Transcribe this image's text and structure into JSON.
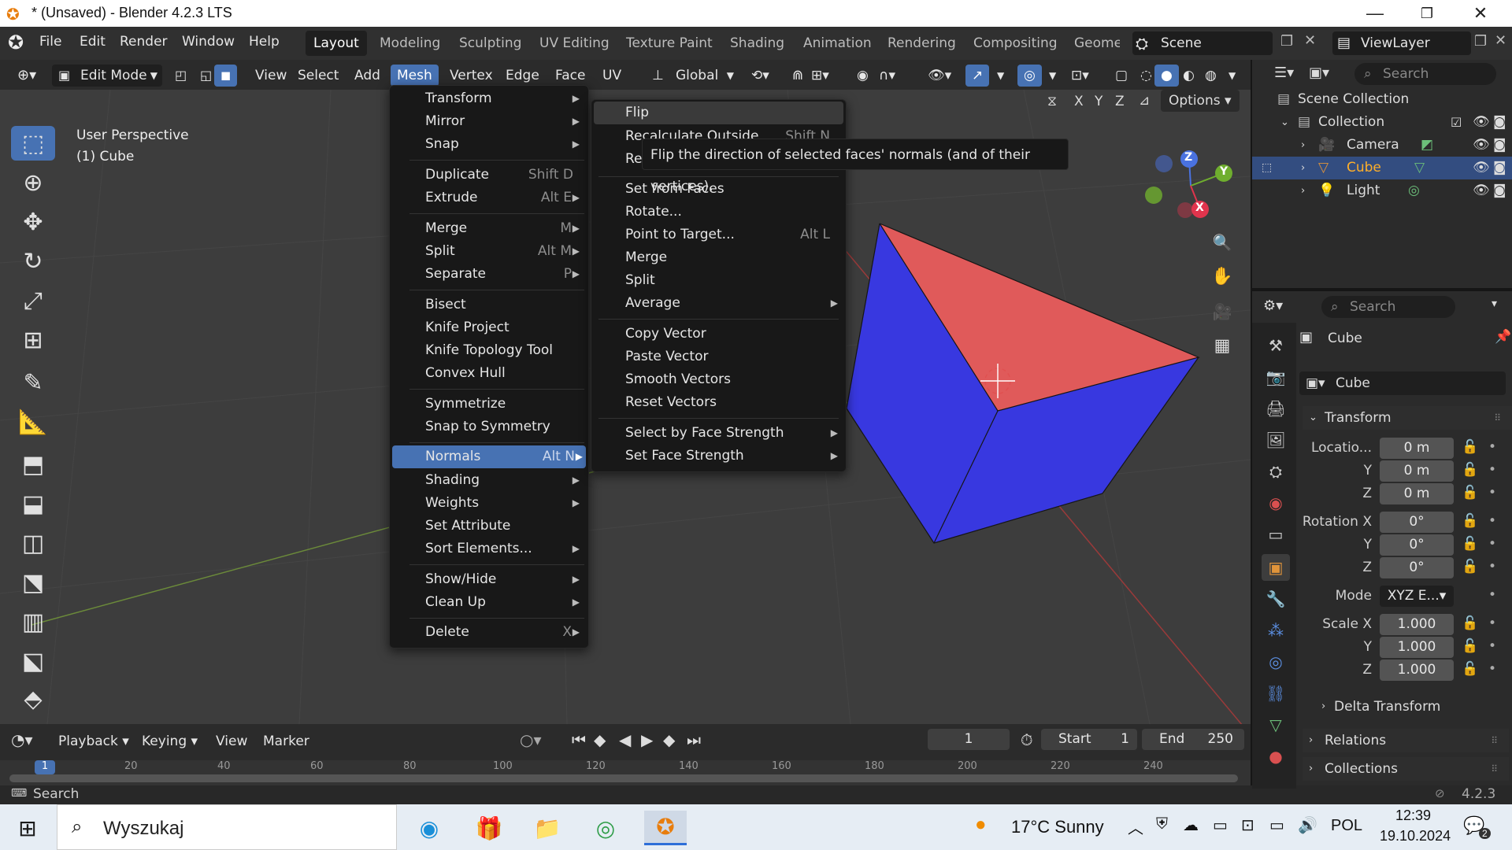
{
  "window": {
    "title": "* (Unsaved) - Blender 4.2.3 LTS"
  },
  "topbar": {
    "menus": [
      "File",
      "Edit",
      "Render",
      "Window",
      "Help"
    ],
    "workspaces": [
      "Layout",
      "Modeling",
      "Sculpting",
      "UV Editing",
      "Texture Paint",
      "Shading",
      "Animation",
      "Rendering",
      "Compositing",
      "Geome"
    ],
    "scene": "Scene",
    "view_layer": "ViewLayer"
  },
  "viewport_header": {
    "mode": "Edit Mode",
    "menus": [
      "View",
      "Select",
      "Add",
      "Mesh",
      "Vertex",
      "Edge",
      "Face",
      "UV"
    ],
    "orientation": "Global",
    "axes": [
      "X",
      "Y",
      "Z"
    ],
    "options": "Options"
  },
  "viewport": {
    "perspective": "User Perspective",
    "object": "(1) Cube"
  },
  "mesh_menu": [
    {
      "label": "Transform",
      "shortcut": "",
      "sub": true
    },
    {
      "label": "Mirror",
      "shortcut": "",
      "sub": true
    },
    {
      "label": "Snap",
      "shortcut": "",
      "sub": true
    },
    {
      "label": "Duplicate",
      "shortcut": "Shift D",
      "sub": false
    },
    {
      "label": "Extrude",
      "shortcut": "Alt E",
      "sub": true
    },
    {
      "label": "Merge",
      "shortcut": "M",
      "sub": true
    },
    {
      "label": "Split",
      "shortcut": "Alt M",
      "sub": true
    },
    {
      "label": "Separate",
      "shortcut": "P",
      "sub": true
    },
    {
      "label": "Bisect",
      "shortcut": "",
      "sub": false
    },
    {
      "label": "Knife Project",
      "shortcut": "",
      "sub": false
    },
    {
      "label": "Knife Topology Tool",
      "shortcut": "",
      "sub": false
    },
    {
      "label": "Convex Hull",
      "shortcut": "",
      "sub": false
    },
    {
      "label": "Symmetrize",
      "shortcut": "",
      "sub": false
    },
    {
      "label": "Snap to Symmetry",
      "shortcut": "",
      "sub": false
    },
    {
      "label": "Normals",
      "shortcut": "Alt N",
      "sub": true
    },
    {
      "label": "Shading",
      "shortcut": "",
      "sub": true
    },
    {
      "label": "Weights",
      "shortcut": "",
      "sub": true
    },
    {
      "label": "Set Attribute",
      "shortcut": "",
      "sub": false
    },
    {
      "label": "Sort Elements...",
      "shortcut": "",
      "sub": true
    },
    {
      "label": "Show/Hide",
      "shortcut": "",
      "sub": true
    },
    {
      "label": "Clean Up",
      "shortcut": "",
      "sub": true
    },
    {
      "label": "Delete",
      "shortcut": "X",
      "sub": true
    }
  ],
  "normals_menu": [
    {
      "label": "Flip",
      "shortcut": "",
      "sub": false
    },
    {
      "label": "Recalculate Outside",
      "shortcut": "Shift N",
      "sub": false
    },
    {
      "label": "Re",
      "shortcut": "",
      "sub": false
    },
    {
      "label": "Set from Faces",
      "shortcut": "",
      "sub": false
    },
    {
      "label": "Rotate...",
      "shortcut": "",
      "sub": false
    },
    {
      "label": "Point to Target...",
      "shortcut": "Alt L",
      "sub": false
    },
    {
      "label": "Merge",
      "shortcut": "",
      "sub": false
    },
    {
      "label": "Split",
      "shortcut": "",
      "sub": false
    },
    {
      "label": "Average",
      "shortcut": "",
      "sub": true
    },
    {
      "label": "Copy Vector",
      "shortcut": "",
      "sub": false
    },
    {
      "label": "Paste Vector",
      "shortcut": "",
      "sub": false
    },
    {
      "label": "Smooth Vectors",
      "shortcut": "",
      "sub": false
    },
    {
      "label": "Reset Vectors",
      "shortcut": "",
      "sub": false
    },
    {
      "label": "Select by Face Strength",
      "shortcut": "",
      "sub": true
    },
    {
      "label": "Set Face Strength",
      "shortcut": "",
      "sub": true
    }
  ],
  "tooltip": "Flip the direction of selected faces' normals (and of their vertices).",
  "gizmo": {
    "z": "Z",
    "y": "Y",
    "x": "X"
  },
  "timeline": {
    "menus": [
      "Playback",
      "Keying",
      "View",
      "Marker"
    ],
    "current_frame": "1",
    "start_label": "Start",
    "start": "1",
    "end_label": "End",
    "end": "250",
    "ruler": [
      "1",
      "20",
      "40",
      "60",
      "80",
      "100",
      "120",
      "140",
      "160",
      "180",
      "200",
      "220",
      "240"
    ]
  },
  "statusbar": {
    "search": "Search",
    "version": "4.2.3"
  },
  "outliner": {
    "search_placeholder": "Search",
    "scene_collection": "Scene Collection",
    "collection": "Collection",
    "items": [
      "Camera",
      "Cube",
      "Light"
    ]
  },
  "properties": {
    "search_placeholder": "Search",
    "object_name": "Cube",
    "object_field": "Cube",
    "transform": "Transform",
    "location_label": "Locatio...",
    "location": [
      "0 m",
      "0 m",
      "0 m"
    ],
    "rotation_label": "Rotation X",
    "rotation": [
      "0°",
      "0°",
      "0°"
    ],
    "mode_label": "Mode",
    "mode": "XYZ E...",
    "scale_label": "Scale X",
    "scale": [
      "1.000",
      "1.000",
      "1.000"
    ],
    "axis_y": "Y",
    "axis_z": "Z",
    "delta": "Delta Transform",
    "relations": "Relations",
    "collections": "Collections"
  },
  "taskbar": {
    "search": "Wyszukaj",
    "weather": "17°C  Sunny",
    "lang": "POL",
    "time": "12:39",
    "date": "19.10.2024",
    "notif": "2"
  },
  "colors": {
    "accent": "#4772b3",
    "cube_top": "#e05a5a",
    "cube_side": "#3838e0",
    "viewport": "#3d3d3d"
  }
}
